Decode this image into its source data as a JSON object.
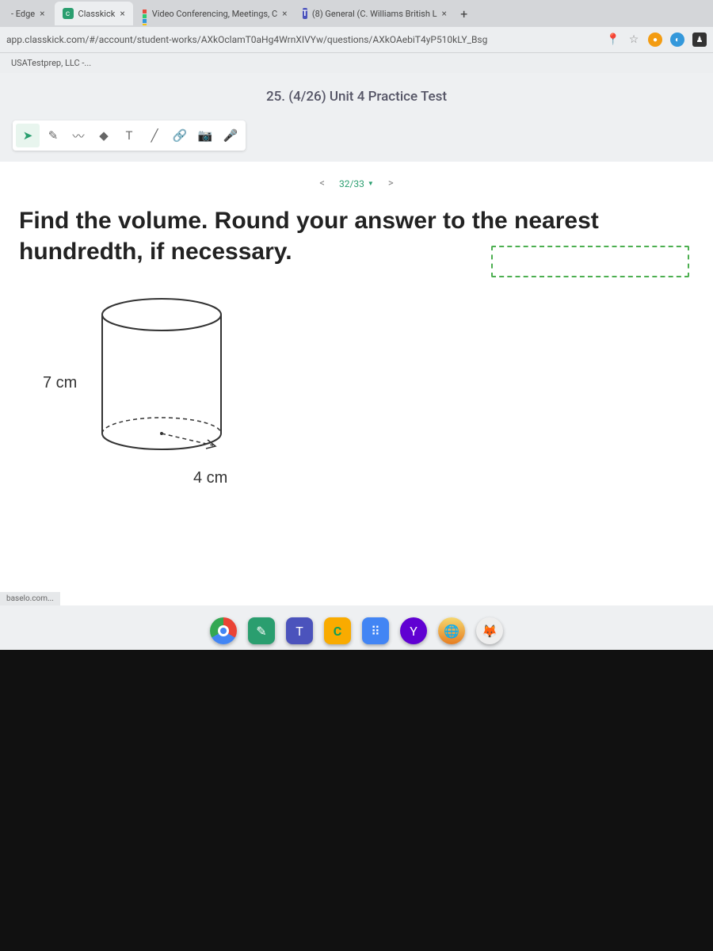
{
  "browser": {
    "tabs": [
      {
        "label": "- Edge"
      },
      {
        "label": "Classkick"
      },
      {
        "label": "Video Conferencing, Meetings, C"
      },
      {
        "label": "(8) General (C. Williams British L"
      }
    ],
    "url": "app.classkick.com/#/account/student-works/AXkOclamT0aHg4WrnXIVYw/questions/AXkOAebiT4yP510kLY_Bsg",
    "bookmarks": [
      {
        "label": "USATestprep, LLC -..."
      }
    ]
  },
  "assignment": {
    "title": "25. (4/26) Unit 4 Practice Test",
    "pager": {
      "current": "32/33"
    }
  },
  "question": {
    "prompt": "Find the volume. Round your answer to the nearest hundredth, if necessary.",
    "height_label": "7 cm",
    "radius_label": "4 cm"
  },
  "status": {
    "corner": "baselo.com..."
  },
  "chart_data": {
    "type": "diagram",
    "shape": "cylinder",
    "height_cm": 7,
    "radius_cm": 4,
    "labels": {
      "height": "7 cm",
      "radius": "4 cm"
    }
  }
}
